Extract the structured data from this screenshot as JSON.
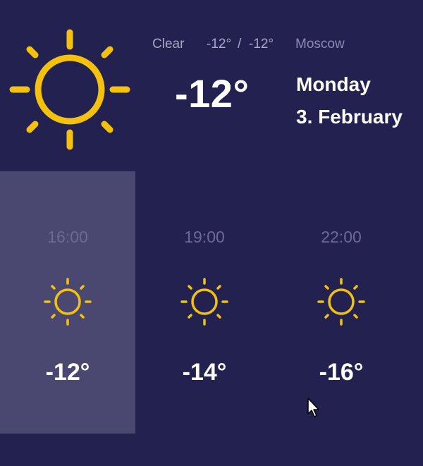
{
  "current": {
    "condition": "Clear",
    "temp_high": "-12°",
    "separator": "/",
    "temp_low": "-12°",
    "city": "Moscow",
    "temperature": "-12°",
    "day": "Monday",
    "date": "3. February",
    "icon": "sun-icon"
  },
  "forecast": [
    {
      "time": "16:00",
      "temperature": "-12°",
      "icon": "sun-icon",
      "selected": true
    },
    {
      "time": "19:00",
      "temperature": "-14°",
      "icon": "sun-icon",
      "selected": false
    },
    {
      "time": "22:00",
      "temperature": "-16°",
      "icon": "sun-icon",
      "selected": false
    }
  ],
  "colors": {
    "background": "#232150",
    "selected_slot": "#4a4870",
    "sun": "#f4c20d",
    "text_primary": "#ffffff",
    "text_muted": "#a9a6c7"
  }
}
